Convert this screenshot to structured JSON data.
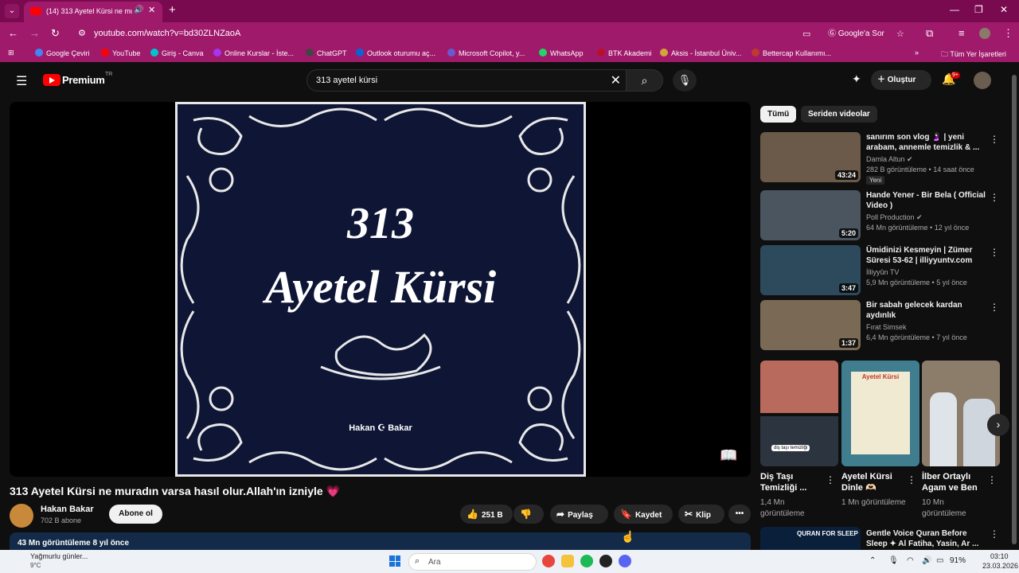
{
  "browser": {
    "tab_title": "(14) 313 Ayetel Kürsi ne mu",
    "url": "youtube.com/watch?v=bd30ZLNZaoA",
    "google_sor": "Google'a Sor",
    "bookmarks": [
      "Google Çeviri",
      "YouTube",
      "Giriş - Canva",
      "Online Kurslar - İste...",
      "ChatGPT",
      "Outlook oturumu aç...",
      "Microsoft Copilot, y...",
      "WhatsApp",
      "BTK Akademi",
      "Aksis - İstanbul Üniv...",
      "Bettercap Kullanımı..."
    ],
    "bookmarks_more": "»",
    "all_bookmarks": "Tüm Yer İşaretleri"
  },
  "youtube": {
    "logo_text": "Premium",
    "region": "TR",
    "search_query": "313 ayetel kürsi",
    "create_label": "Oluştur",
    "notif_badge": "9+"
  },
  "video": {
    "art_line1": "313",
    "art_line2": "Ayetel Kürsi",
    "art_brand": "Hakan ☪ Bakar",
    "title": "313 Ayetel Kürsi ne muradın varsa hasıl olur.Allah'ın izniyle 💗",
    "channel": "Hakan Bakar",
    "subscribers": "702 B abone",
    "subscribe_label": "Abone ol",
    "likes": "251 B",
    "share_label": "Paylaş",
    "save_label": "Kaydet",
    "clip_label": "Klip",
    "stats": "43 Mn görüntüleme  8 yıl önce"
  },
  "chips": [
    "Tümü",
    "Seriden videolar"
  ],
  "recommendations": [
    {
      "title": "sanırım son vlog 🤰🏻 | yeni arabam, annemle temizlik & ...",
      "channel": "Damla Altun ✔",
      "meta": "282 B görüntüleme • 14 saat önce",
      "duration": "43:24",
      "badge": "Yeni",
      "color": "#6b5a49"
    },
    {
      "title": "Hande Yener - Bir Bela ( Official Video )",
      "channel": "Poll Production ✔",
      "meta": "64 Mn görüntüleme • 12 yıl önce",
      "duration": "5:20",
      "badge": "",
      "color": "#4a5560"
    },
    {
      "title": "Ümidinizi Kesmeyin | Zümer Süresi 53-62 | illiyyuntv.com",
      "channel": "İlliyyûn TV",
      "meta": "5,9 Mn görüntüleme • 5 yıl önce",
      "duration": "3:47",
      "badge": "",
      "color": "#2d4a5c"
    },
    {
      "title": "Bir sabah gelecek kardan aydınlık",
      "channel": "Fırat Simsek",
      "meta": "6,4 Mn görüntüleme • 7 yıl önce",
      "duration": "1:37",
      "badge": "",
      "color": "#7a6a55"
    }
  ],
  "shorts": [
    {
      "title": "Diş Taşı Temizliği ...",
      "meta": "1,4 Mn görüntüleme",
      "color": "#b86a5c"
    },
    {
      "title": "Ayetel Kürsi Dinle 🫶🏻",
      "meta": "1 Mn görüntüleme",
      "color": "#3f7d8f"
    },
    {
      "title": "İlber Ortaylı Agam ve Ben",
      "meta": "10 Mn görüntüleme",
      "color": "#8c7c6a"
    }
  ],
  "next_rec": {
    "title": "Gentle Voice Quran Before Sleep ✦ Al Fatiha, Yasin, Ar ...",
    "thumb_text": "QURAN FOR SLEEP"
  },
  "taskbar": {
    "weather_line1": "Yağmurlu günler...",
    "weather_line2": "9°C",
    "search_placeholder": "Ara",
    "battery": "91%",
    "time": "03:10",
    "date": "23.03.2026"
  }
}
